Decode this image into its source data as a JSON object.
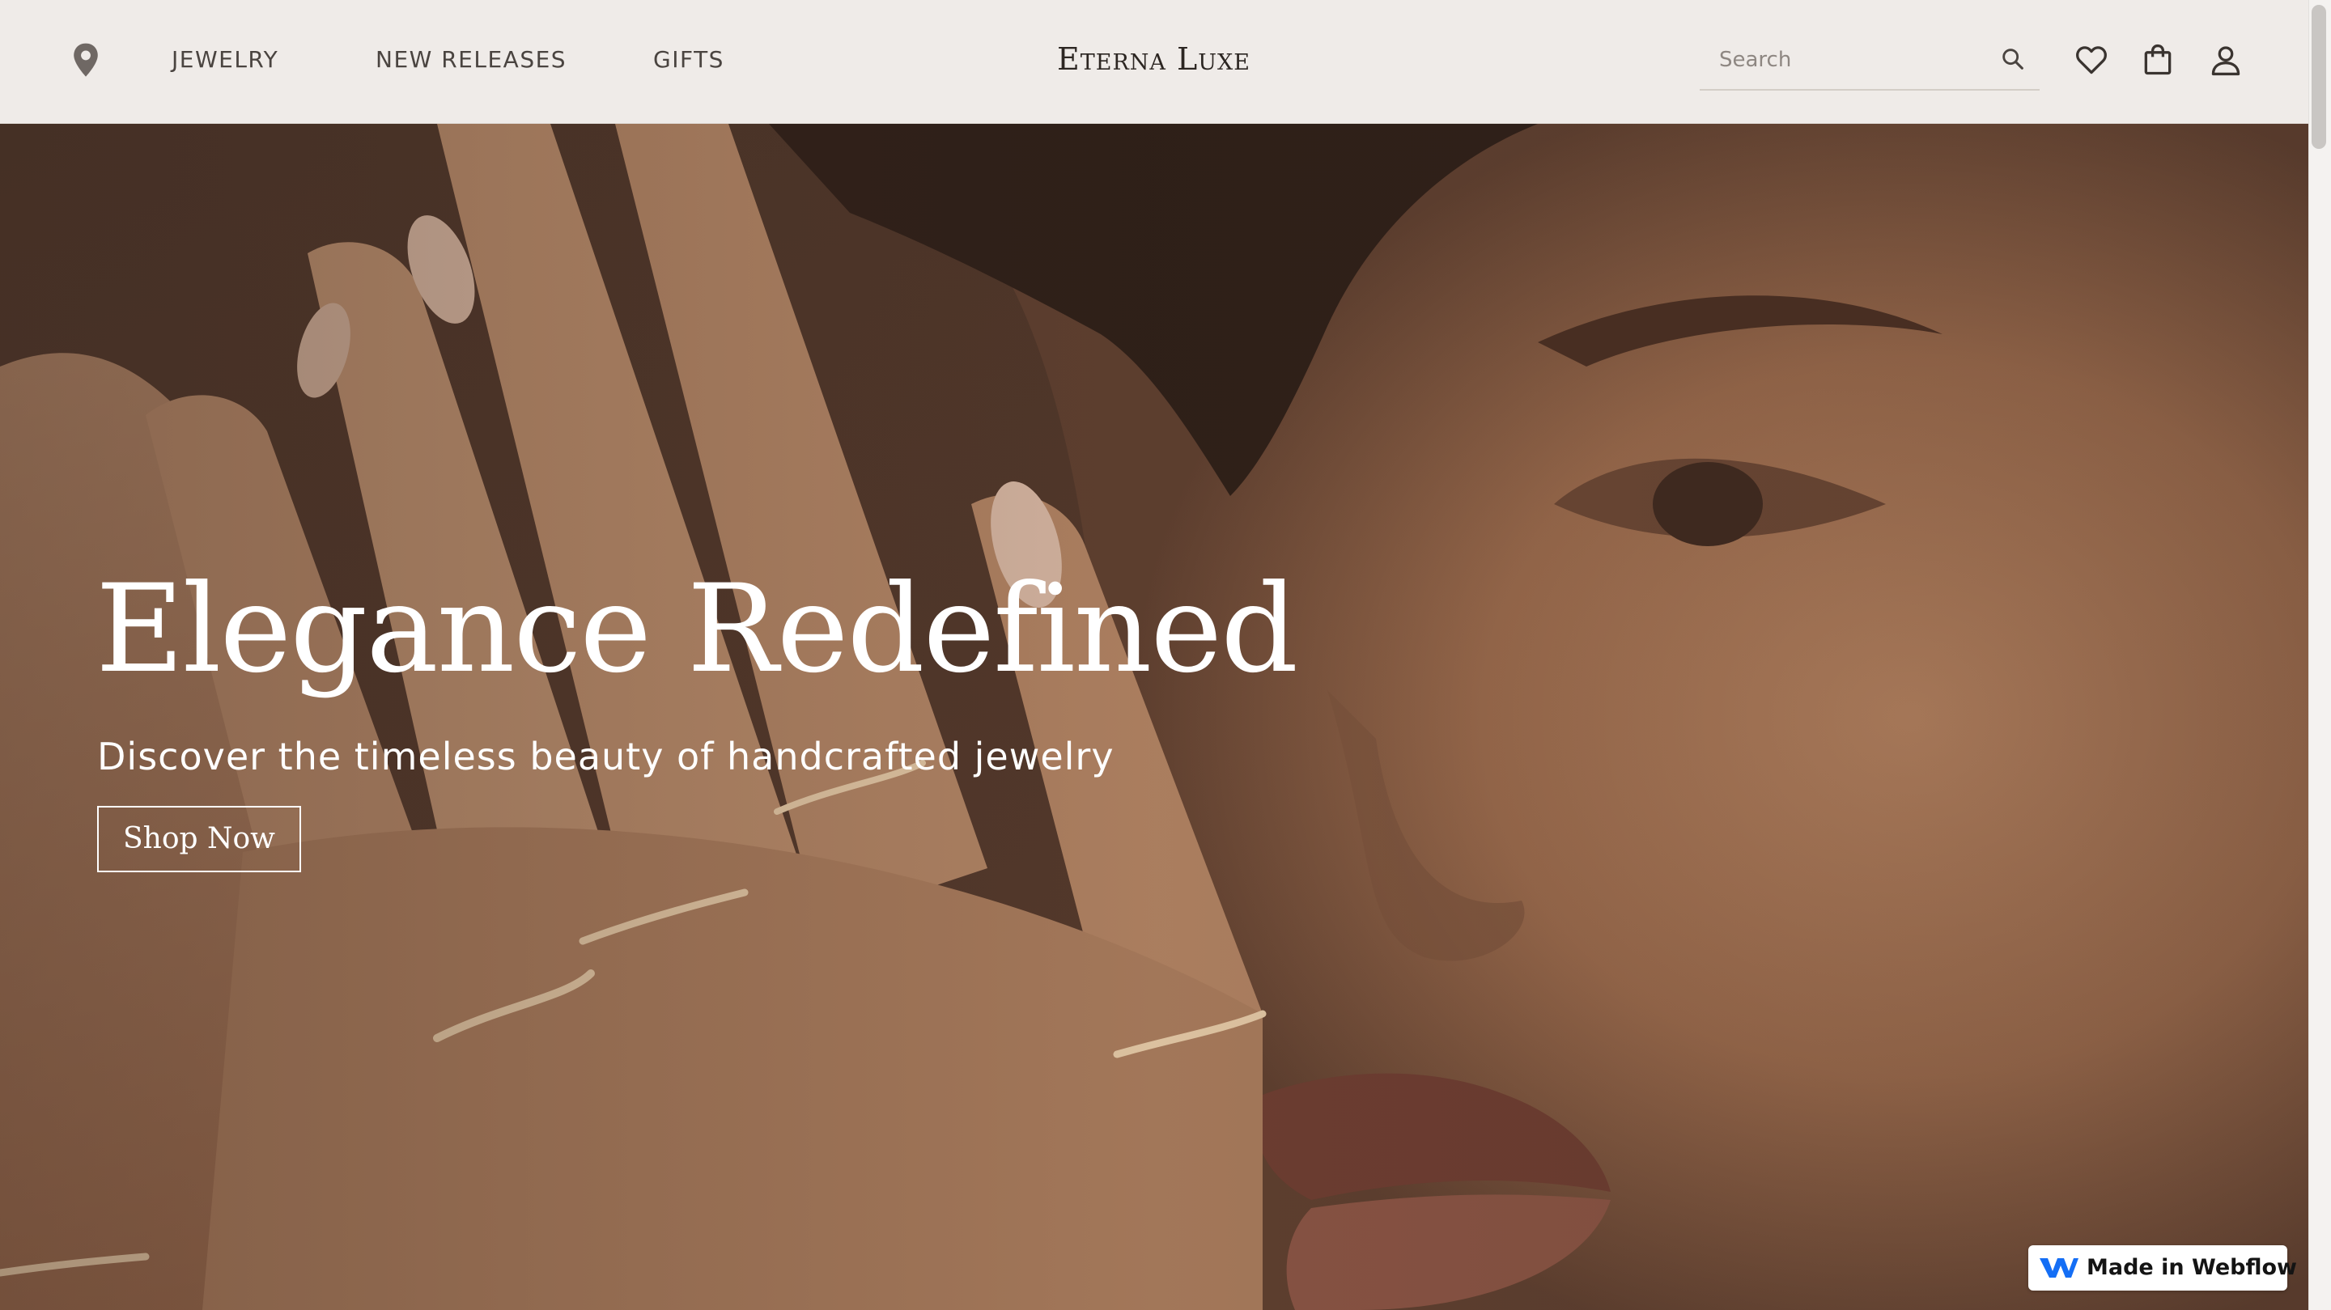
{
  "header": {
    "location_icon": "map-pin-icon",
    "nav": [
      {
        "label": "JEWELRY"
      },
      {
        "label": "NEW RELEASES"
      },
      {
        "label": "GIFTS"
      }
    ],
    "brand": "Eterna Luxe",
    "search": {
      "placeholder": "Search",
      "value": "",
      "icon": "search-icon"
    },
    "icons": [
      "heart-icon",
      "shopping-bag-icon",
      "user-icon"
    ]
  },
  "hero": {
    "title": "Elegance Redefined",
    "subtitle": "Discover the timeless beauty of handcrafted jewelry",
    "cta_label": "Shop Now"
  },
  "badge": {
    "label": "Made in Webflow",
    "icon": "webflow-logo-icon"
  },
  "colors": {
    "header_bg": "#efebe8",
    "text_dark": "#2c2622",
    "hero_tint": "#6e4c38",
    "white": "#ffffff",
    "webflow_blue": "#146ef5"
  }
}
